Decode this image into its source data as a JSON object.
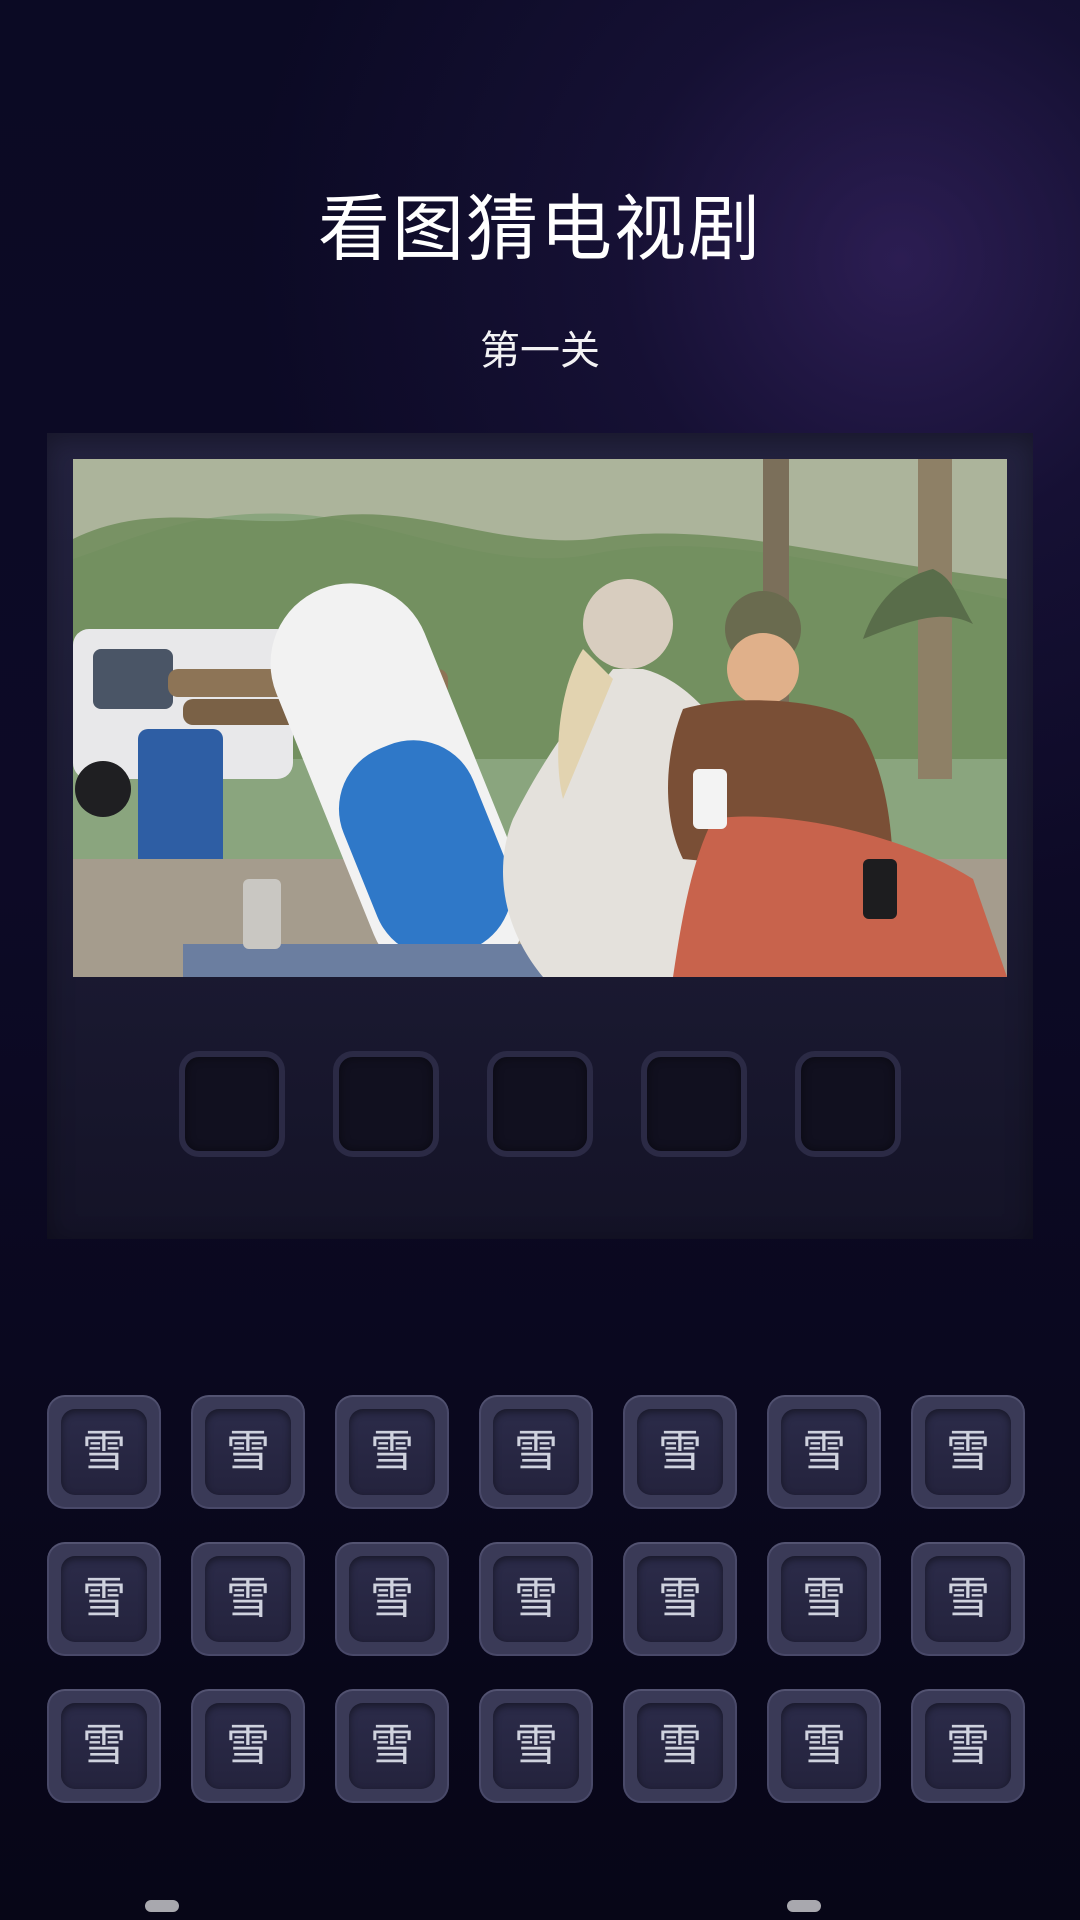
{
  "header": {
    "title": "看图猜电视剧",
    "level": "第一关"
  },
  "photo": {
    "alt": ""
  },
  "answer_slots": [
    "",
    "",
    "",
    "",
    ""
  ],
  "tiles": [
    "雪",
    "雪",
    "雪",
    "雪",
    "雪",
    "雪",
    "雪",
    "雪",
    "雪",
    "雪",
    "雪",
    "雪",
    "雪",
    "雪",
    "雪",
    "雪",
    "雪",
    "雪",
    "雪",
    "雪",
    "雪"
  ]
}
